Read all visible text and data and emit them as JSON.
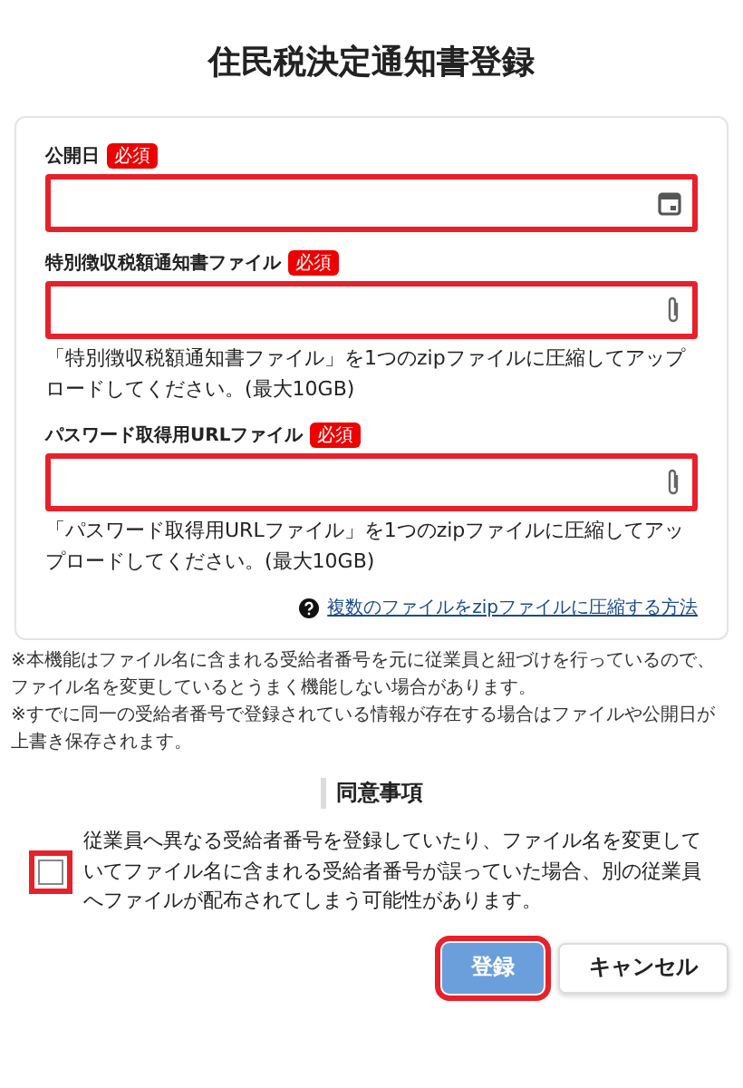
{
  "title": "住民税決定通知書登録",
  "fields": [
    {
      "label": "公開日",
      "badge": "必須",
      "kind": "date",
      "error": true
    },
    {
      "label": "特別徴収税額通知書ファイル",
      "badge": "必須",
      "kind": "file",
      "error": true,
      "hint": "「特別徴収税額通知書ファイル」を1つのzipファイルに圧縮してアップロードしてください。(最大10GB)"
    },
    {
      "label": "パスワード取得用URLファイル",
      "badge": "必須",
      "kind": "file",
      "error": true,
      "hint": "「パスワード取得用URLファイル」を1つのzipファイルに圧縮してアップロードしてください。(最大10GB)"
    }
  ],
  "help_link": "複数のファイルをzipファイルに圧縮する方法",
  "notes": [
    "※本機能はファイル名に含まれる受給者番号を元に従業員と紐づけを行っているので、ファイル名を変更しているとうまく機能しない場合があります。",
    "※すでに同一の受給者番号で登録されている情報が存在する場合はファイルや公開日が上書き保存されます。"
  ],
  "agreement": {
    "heading": "同意事項",
    "text": "従業員へ異なる受給者番号を登録していたり、ファイル名を変更していてファイル名に含まれる受給者番号が誤っていた場合、別の従業員へファイルが配布されてしまう可能性があります。",
    "checked": false,
    "error": true
  },
  "buttons": [
    {
      "label": "登録",
      "kind": "primary",
      "disabled": true,
      "error": true
    },
    {
      "label": "キャンセル",
      "kind": "secondary",
      "error": false
    }
  ]
}
